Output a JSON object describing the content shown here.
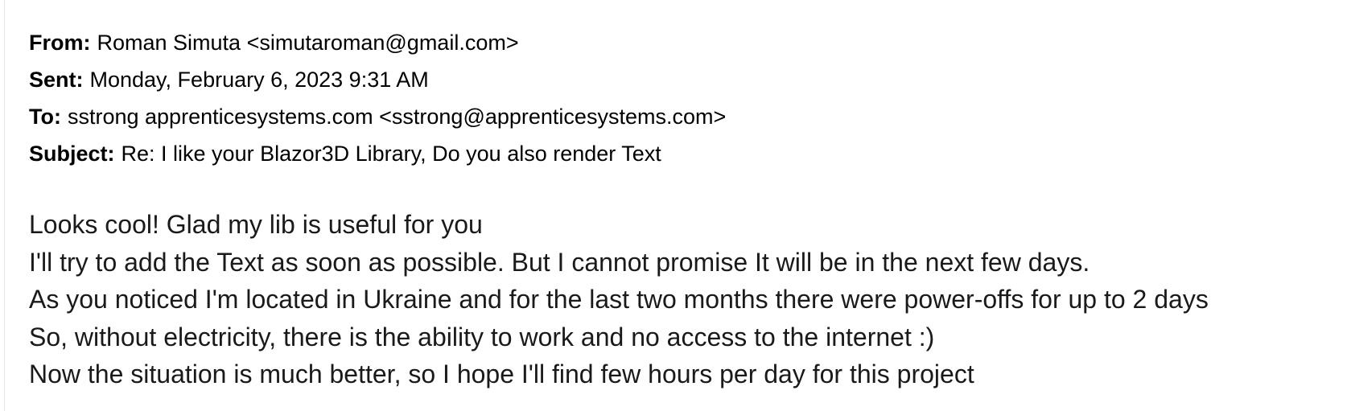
{
  "headers": [
    {
      "key": "From:",
      "value": "Roman Simuta <simutaroman@gmail.com>"
    },
    {
      "key": "Sent:",
      "value": "Monday, February 6, 2023 9:31 AM"
    },
    {
      "key": "To:",
      "value": "sstrong apprenticesystems.com <sstrong@apprenticesystems.com>"
    },
    {
      "key": "Subject:",
      "value": "Re: I like your Blazor3D Library, Do you also render Text"
    }
  ],
  "body_lines": [
    "Looks cool! Glad my lib is useful for you",
    "I'll try to add the Text as soon as possible. But I cannot promise It will be in the next few days.",
    "As you noticed I'm located in Ukraine and for the last two months there were power-offs for up to 2 days",
    "So, without electricity, there is the ability to work and no access to the internet  :)",
    "Now the situation is much better, so I hope I'll find few hours per day for this project"
  ]
}
